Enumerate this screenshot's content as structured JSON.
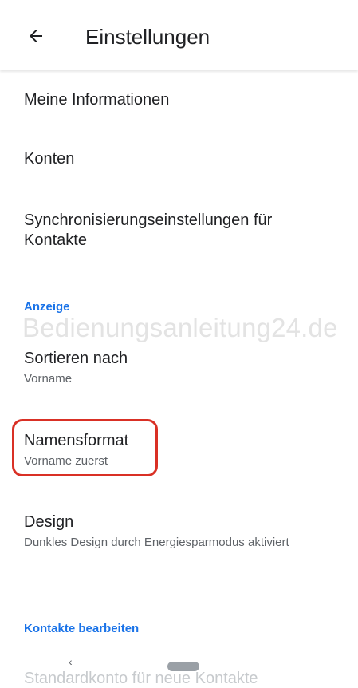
{
  "header": {
    "title": "Einstellungen",
    "back_icon": "arrow-back-icon"
  },
  "settings": {
    "my_info": "Meine Informationen",
    "accounts": "Konten",
    "sync": "Synchronisierungseinstellungen für Kontakte"
  },
  "display_section": {
    "header": "Anzeige",
    "sort_title": "Sortieren nach",
    "sort_value": "Vorname",
    "name_format_title": "Namensformat",
    "name_format_value": "Vorname zuerst",
    "design_title": "Design",
    "design_value": "Dunkles Design durch Energiesparmodus aktiviert"
  },
  "edit_section": {
    "header": "Kontakte bearbeiten",
    "default_account": "Standardkonto für neue Kontakte"
  },
  "watermark": "Bedienungsanleitung24.de",
  "navbar": {
    "back_glyph": "‹"
  },
  "colors": {
    "accent": "#1a73e8",
    "highlight": "#d93025"
  }
}
